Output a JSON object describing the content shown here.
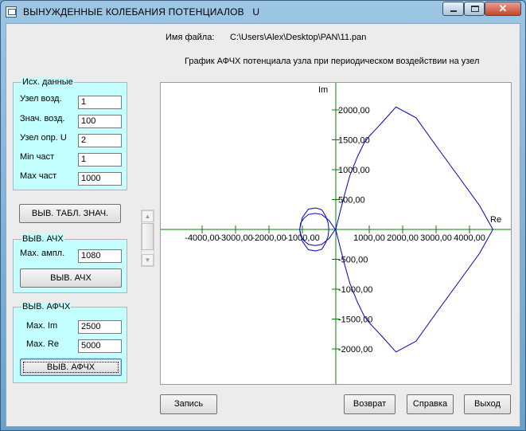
{
  "window": {
    "title": "ВЫНУЖДЕННЫЕ КОЛЕБАНИЯ ПОТЕНЦИАЛОВ   U",
    "close_glyph": "✕"
  },
  "file": {
    "label": "Имя файла:",
    "path": "C:\\Users\\Alex\\Desktop\\PAN\\11.pan"
  },
  "plot_title": "График АФЧХ потенциала  узла при периодическом воздействии на узел",
  "input_group": {
    "title": "Исх. данные",
    "fields": [
      {
        "label": "Узел  возд.",
        "value": "1"
      },
      {
        "label": "Знач. возд.",
        "value": "100"
      },
      {
        "label": "Узел опр. U",
        "value": "2"
      },
      {
        "label": "Min част",
        "value": "1"
      },
      {
        "label": "Max част",
        "value": "1000"
      }
    ]
  },
  "table_button": "ВЫВ. ТАБЛ. ЗНАЧ.",
  "ach_group": {
    "title": "ВЫВ. АЧХ",
    "field_label": "Мах. ампл.",
    "field_value": "1080",
    "button": "ВЫВ. АЧХ"
  },
  "afch_group": {
    "title": "ВЫВ. АФЧХ",
    "im_label": "Max. Im",
    "im_value": "2500",
    "re_label": "Max. Re",
    "re_value": "5000",
    "button": "ВЫВ. АФЧХ"
  },
  "scrollbar": {
    "up_glyph": "▲",
    "down_glyph": "▼"
  },
  "bottom_buttons": {
    "save": "Запись",
    "back": "Возврат",
    "help": "Справка",
    "exit": "Выход"
  },
  "colors": {
    "curve": "#0000c8",
    "axes": "#008000",
    "group_bg": "#c4ffff",
    "form_bg": "#ececec"
  },
  "chart_data": {
    "type": "line",
    "xlabel": "Re",
    "ylabel": "Im",
    "xlim": [
      -5000,
      5000
    ],
    "ylim": [
      -2500,
      2500
    ],
    "x_ticks": [
      -4000,
      -3000,
      -2000,
      -1000,
      1000,
      2000,
      3000,
      4000
    ],
    "y_ticks": [
      2000,
      1500,
      1000,
      500,
      -500,
      -1000,
      -1500,
      -2000
    ],
    "x_tick_labels": [
      "-4000,00",
      "-3000,00",
      "-2000,00",
      "-1000,00",
      "1000,00",
      "2000,00",
      "3000,00",
      "4000,00"
    ],
    "y_tick_labels": [
      "2000,00",
      "1500,00",
      "1000,00",
      "500,00",
      "-500,00",
      "-1000,00",
      "-1500,00",
      "-2000,00"
    ],
    "series": [
      {
        "x": [
          4700,
          4300,
          3600,
          3000,
          2400,
          1800,
          1400,
          1150,
          1000,
          850,
          650,
          420,
          250,
          130,
          60,
          20,
          0,
          -40,
          -200,
          -420,
          -620,
          -820,
          -950,
          -1050,
          -1080,
          -1000,
          -820,
          -600,
          -420,
          -300,
          -230,
          -210,
          -230,
          -300,
          -420,
          -600,
          -820,
          -1000,
          -1080,
          -1050,
          -950,
          -820,
          -620,
          -420,
          -200,
          -40,
          0,
          20,
          60,
          130,
          250,
          420,
          650,
          850,
          1000,
          1150,
          1400,
          1800,
          2400,
          3000,
          3600,
          4300,
          4700
        ],
        "y": [
          0,
          400,
          940,
          1400,
          1870,
          2050,
          1800,
          1650,
          1560,
          1450,
          1220,
          900,
          560,
          300,
          140,
          50,
          0,
          20,
          150,
          250,
          270,
          250,
          190,
          110,
          0,
          -200,
          -340,
          -360,
          -330,
          -220,
          -110,
          0,
          110,
          220,
          330,
          360,
          340,
          200,
          0,
          -110,
          -190,
          -250,
          -270,
          -250,
          -150,
          -20,
          0,
          -50,
          -140,
          -300,
          -560,
          -900,
          -1220,
          -1450,
          -1560,
          -1650,
          -1800,
          -2050,
          -1870,
          -1400,
          -940,
          -400,
          0
        ]
      }
    ]
  }
}
